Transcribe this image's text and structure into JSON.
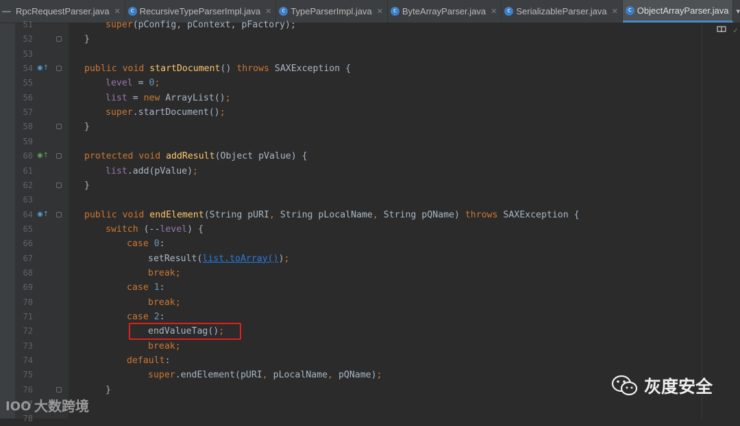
{
  "tabs": [
    {
      "label": "RpcRequestParser.java",
      "icon": false,
      "active": false
    },
    {
      "label": "RecursiveTypeParserImpl.java",
      "icon": true,
      "active": false
    },
    {
      "label": "TypeParserImpl.java",
      "icon": true,
      "active": false
    },
    {
      "label": "ByteArrayParser.java",
      "icon": true,
      "active": false
    },
    {
      "label": "SerializableParser.java",
      "icon": true,
      "active": false
    },
    {
      "label": "ObjectArrayParser.java",
      "icon": true,
      "active": true
    }
  ],
  "close_glyph": "✕",
  "code_lines": [
    {
      "n": "51",
      "marker": "",
      "fold": false,
      "indent": 1,
      "tokens": [
        [
          "k",
          "super"
        ],
        [
          "p",
          "(pConfig, pContext, pFactory);"
        ]
      ]
    },
    {
      "n": "52",
      "marker": "",
      "fold": true,
      "indent": 0,
      "tokens": [
        [
          "p",
          "}"
        ]
      ]
    },
    {
      "n": "53",
      "marker": "",
      "fold": false,
      "indent": 0,
      "tokens": []
    },
    {
      "n": "54",
      "marker": "blue",
      "fold": true,
      "indent": 0,
      "tokens": [
        [
          "k",
          "public void "
        ],
        [
          "f",
          "startDocument"
        ],
        [
          "p",
          "() "
        ],
        [
          "k",
          "throws "
        ],
        [
          "p",
          "SAXException {"
        ]
      ]
    },
    {
      "n": "55",
      "marker": "",
      "fold": false,
      "indent": 1,
      "tokens": [
        [
          "v",
          "level"
        ],
        [
          "p",
          " = "
        ],
        [
          "n",
          "0"
        ],
        [
          "k",
          ";"
        ]
      ]
    },
    {
      "n": "56",
      "marker": "",
      "fold": false,
      "indent": 1,
      "tokens": [
        [
          "v",
          "list"
        ],
        [
          "p",
          " = "
        ],
        [
          "k",
          "new "
        ],
        [
          "p",
          "ArrayList()"
        ],
        [
          "k",
          ";"
        ]
      ]
    },
    {
      "n": "57",
      "marker": "",
      "fold": false,
      "indent": 1,
      "tokens": [
        [
          "k",
          "super"
        ],
        [
          "p",
          ".startDocument()"
        ],
        [
          "k",
          ";"
        ]
      ]
    },
    {
      "n": "58",
      "marker": "",
      "fold": true,
      "indent": 0,
      "tokens": [
        [
          "p",
          "}"
        ]
      ]
    },
    {
      "n": "59",
      "marker": "",
      "fold": false,
      "indent": 0,
      "tokens": []
    },
    {
      "n": "60",
      "marker": "green",
      "fold": true,
      "indent": 0,
      "tokens": [
        [
          "k",
          "protected void "
        ],
        [
          "f",
          "addResult"
        ],
        [
          "p",
          "(Object pValue) {"
        ]
      ]
    },
    {
      "n": "61",
      "marker": "",
      "fold": false,
      "indent": 1,
      "tokens": [
        [
          "v",
          "list"
        ],
        [
          "p",
          ".add(pValue)"
        ],
        [
          "k",
          ";"
        ]
      ]
    },
    {
      "n": "62",
      "marker": "",
      "fold": true,
      "indent": 0,
      "tokens": [
        [
          "p",
          "}"
        ]
      ]
    },
    {
      "n": "63",
      "marker": "",
      "fold": false,
      "indent": 0,
      "tokens": []
    },
    {
      "n": "64",
      "marker": "blue",
      "fold": true,
      "indent": 0,
      "tokens": [
        [
          "k",
          "public void "
        ],
        [
          "f",
          "endElement"
        ],
        [
          "p",
          "(String pURI"
        ],
        [
          "k",
          ", "
        ],
        [
          "p",
          "String pLocalName"
        ],
        [
          "k",
          ", "
        ],
        [
          "p",
          "String pQName) "
        ],
        [
          "k",
          "throws "
        ],
        [
          "p",
          "SAXException {"
        ]
      ]
    },
    {
      "n": "65",
      "marker": "",
      "fold": false,
      "indent": 1,
      "tokens": [
        [
          "k",
          "switch "
        ],
        [
          "p",
          "(--"
        ],
        [
          "v",
          "level"
        ],
        [
          "p",
          ") {"
        ]
      ]
    },
    {
      "n": "66",
      "marker": "",
      "fold": false,
      "indent": 2,
      "tokens": [
        [
          "k",
          "case "
        ],
        [
          "n",
          "0"
        ],
        [
          "p",
          ":"
        ]
      ]
    },
    {
      "n": "67",
      "marker": "",
      "fold": false,
      "indent": 3,
      "tokens": [
        [
          "p",
          "setResult("
        ],
        [
          "u",
          "list.toArray()"
        ],
        [
          "p",
          ")"
        ],
        [
          "k",
          ";"
        ]
      ]
    },
    {
      "n": "68",
      "marker": "",
      "fold": false,
      "indent": 3,
      "tokens": [
        [
          "k",
          "break;"
        ]
      ]
    },
    {
      "n": "69",
      "marker": "",
      "fold": false,
      "indent": 2,
      "tokens": [
        [
          "k",
          "case "
        ],
        [
          "n",
          "1"
        ],
        [
          "p",
          ":"
        ]
      ]
    },
    {
      "n": "70",
      "marker": "",
      "fold": false,
      "indent": 3,
      "tokens": [
        [
          "k",
          "break;"
        ]
      ]
    },
    {
      "n": "71",
      "marker": "",
      "fold": false,
      "indent": 2,
      "tokens": [
        [
          "k",
          "case "
        ],
        [
          "n",
          "2"
        ],
        [
          "p",
          ":"
        ]
      ]
    },
    {
      "n": "72",
      "marker": "",
      "fold": false,
      "indent": 3,
      "tokens": [
        [
          "p",
          "endValueTag()"
        ],
        [
          "k",
          ";"
        ]
      ]
    },
    {
      "n": "73",
      "marker": "",
      "fold": false,
      "indent": 3,
      "tokens": [
        [
          "k",
          "break;"
        ]
      ]
    },
    {
      "n": "74",
      "marker": "",
      "fold": false,
      "indent": 2,
      "tokens": [
        [
          "k",
          "default"
        ],
        [
          "p",
          ":"
        ]
      ]
    },
    {
      "n": "75",
      "marker": "",
      "fold": false,
      "indent": 3,
      "tokens": [
        [
          "k",
          "super"
        ],
        [
          "p",
          ".endElement(pURI"
        ],
        [
          "k",
          ", "
        ],
        [
          "p",
          "pLocalName"
        ],
        [
          "k",
          ", "
        ],
        [
          "p",
          "pQName)"
        ],
        [
          "k",
          ";"
        ]
      ]
    },
    {
      "n": "76",
      "marker": "",
      "fold": true,
      "indent": 1,
      "tokens": [
        [
          "p",
          "}"
        ]
      ]
    },
    {
      "n": "77",
      "marker": "",
      "fold": false,
      "indent": 0,
      "tokens": []
    },
    {
      "n": "78",
      "marker": "",
      "fold": false,
      "indent": 0,
      "tokens": []
    }
  ],
  "highlighted_line": "72",
  "watermark_left": "大数跨境",
  "watermark_right": "灰度安全",
  "colors": {
    "keyword": "#cc7832",
    "function": "#ffc66d",
    "number": "#6897bb",
    "field": "#9876aa",
    "link": "#287bde",
    "highlight_box": "#e0201f"
  }
}
